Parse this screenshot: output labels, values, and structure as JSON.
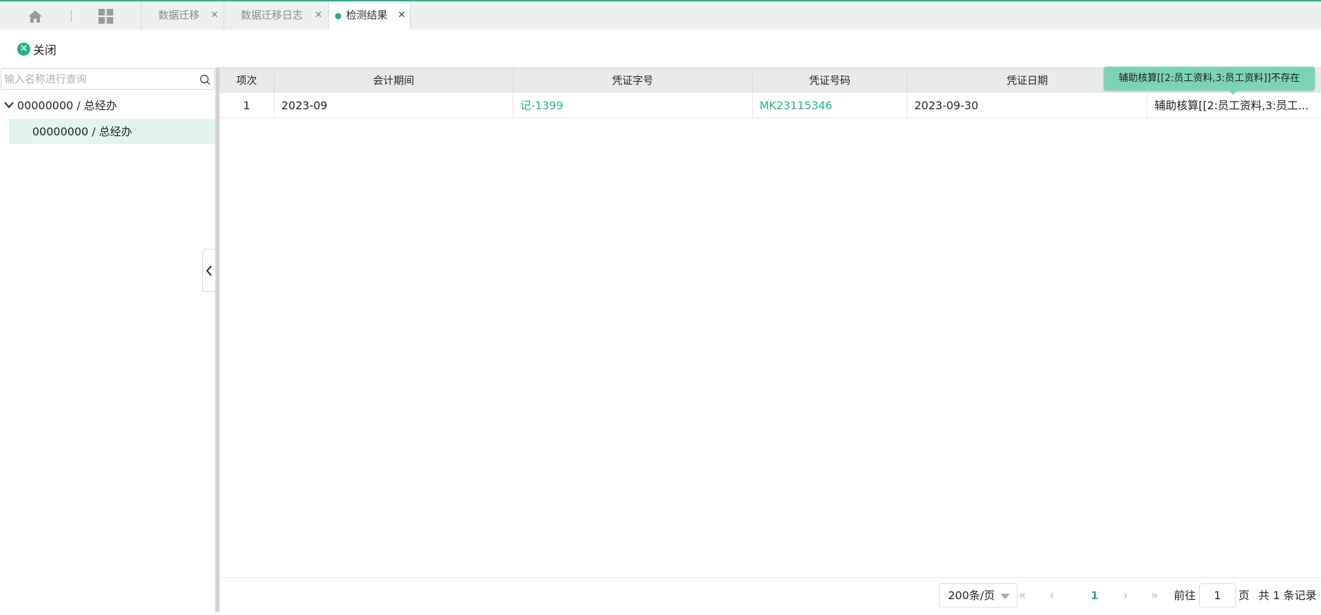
{
  "tabs": [
    {
      "label": "数据迁移",
      "active": false
    },
    {
      "label": "数据迁移日志",
      "active": false
    },
    {
      "label": "检测结果",
      "active": true
    }
  ],
  "toolbar": {
    "close_label": "关闭"
  },
  "tree": {
    "search_placeholder": "输入名称进行查询",
    "root_label": "00000000 / 总经办",
    "child_label": "00000000 / 总经办"
  },
  "grid": {
    "columns": [
      "项次",
      "会计期间",
      "凭证字号",
      "凭证号码",
      "凭证日期",
      ""
    ],
    "rows": [
      {
        "index": "1",
        "period": "2023-09",
        "voucher_word": "记-1399",
        "voucher_no": "MK23115346",
        "date": "2023-09-30",
        "message": "辅助核算[[2:员工资料,3:员工..."
      }
    ]
  },
  "tooltip": {
    "text": "辅助核算[[2:员工资料,3:员工资料]]不存在"
  },
  "pager": {
    "page_size": "200条/页",
    "current_page": "1",
    "goto_label": "前往",
    "goto_value": "1",
    "page_unit": "页",
    "total_text": "共 1 条记录"
  },
  "colors": {
    "accent": "#1fb38a",
    "tooltip_bg": "#7dd3b7",
    "selected_row": "#e4f5f0"
  }
}
